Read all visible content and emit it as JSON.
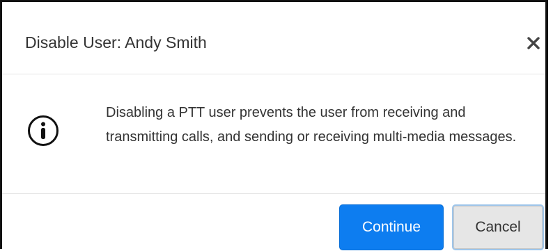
{
  "dialog": {
    "title": "Disable User: Andy Smith",
    "close_icon": "close-icon",
    "message": "Disabling a PTT user prevents the user from receiving and transmitting calls, and sending or receiving multi-media messages.",
    "info_icon": "info-circle-icon",
    "buttons": {
      "continue_label": "Continue",
      "cancel_label": "Cancel"
    }
  },
  "colors": {
    "primary": "#0d7df0",
    "secondary": "#e6e6e6",
    "text": "#333333"
  }
}
